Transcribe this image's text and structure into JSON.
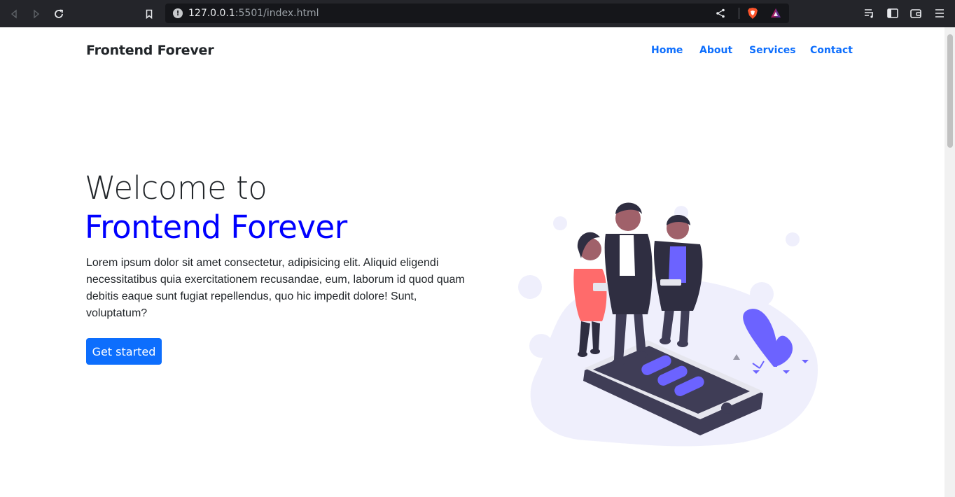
{
  "browser": {
    "url_host": "127.0.0.1",
    "url_rest": ":5501/index.html"
  },
  "site": {
    "brand": "Frontend Forever",
    "nav": [
      "Home",
      "About",
      "Services",
      "Contact"
    ]
  },
  "hero": {
    "line1": "Welcome to",
    "line2": "Frontend Forever",
    "paragraph": "Lorem ipsum dolor sit amet consectetur, adipisicing elit. Aliquid eligendi necessitatibus quia exercitationem recusandae, eum, laborum id quod quam debitis eaque sunt fugiat repellendus, quo hic impedit dolore! Sunt, voluptatum?",
    "button": "Get started"
  },
  "colors": {
    "primary": "#0d6efd",
    "brand_blue": "#0000ff",
    "illustration_accent": "#6c63ff"
  }
}
